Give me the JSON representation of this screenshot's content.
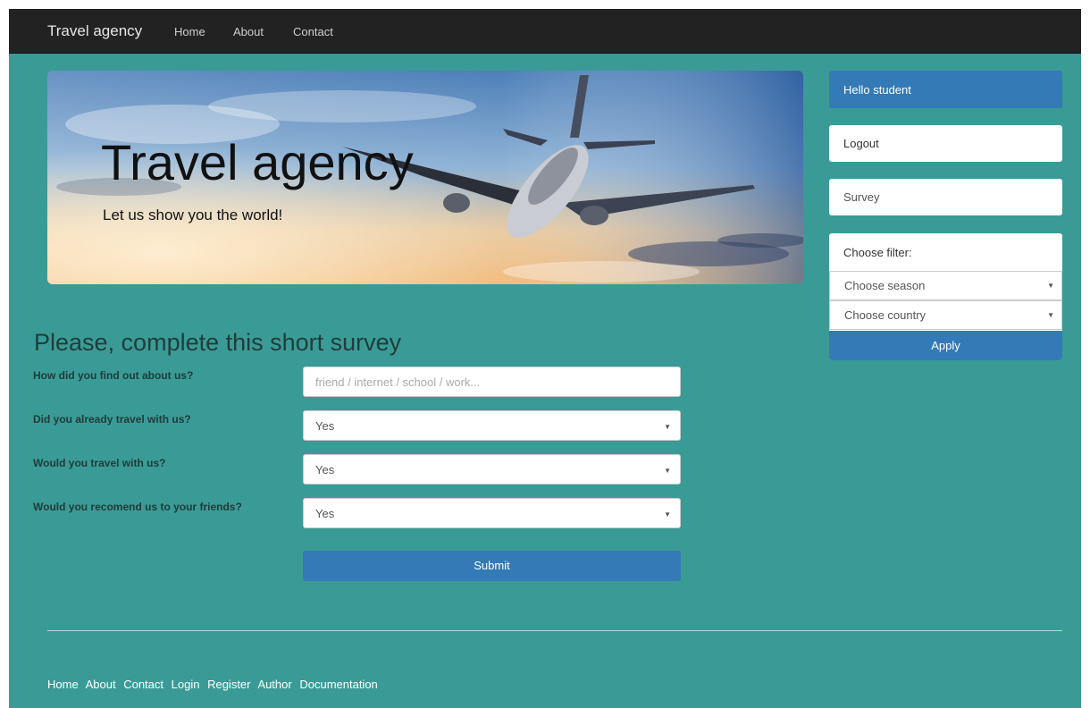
{
  "navbar": {
    "brand": "Travel agency",
    "links": [
      "Home",
      "About",
      "Contact"
    ]
  },
  "hero": {
    "title": "Travel agency",
    "subtitle": "Let us show you the world!"
  },
  "sidebar": {
    "greeting": "Hello student",
    "logout": "Logout",
    "survey": "Survey",
    "filter_label": "Choose filter:",
    "season_select": "Choose season",
    "country_select": "Choose country",
    "apply": "Apply"
  },
  "survey": {
    "title": "Please, complete this short survey",
    "questions": [
      {
        "label": "How did you find out about us?",
        "placeholder": "friend / internet / school / work..."
      },
      {
        "label": "Did you already travel with us?",
        "value": "Yes"
      },
      {
        "label": "Would you travel with us?",
        "value": "Yes"
      },
      {
        "label": "Would you recomend us to your friends?",
        "value": "Yes"
      }
    ],
    "submit": "Submit"
  },
  "footer": {
    "links": [
      "Home",
      "About",
      "Contact",
      "Login",
      "Register",
      "Author",
      "Documentation"
    ]
  },
  "colors": {
    "page_bg": "#3a9b96",
    "navbar_bg": "#222222",
    "primary": "#337ab7"
  }
}
